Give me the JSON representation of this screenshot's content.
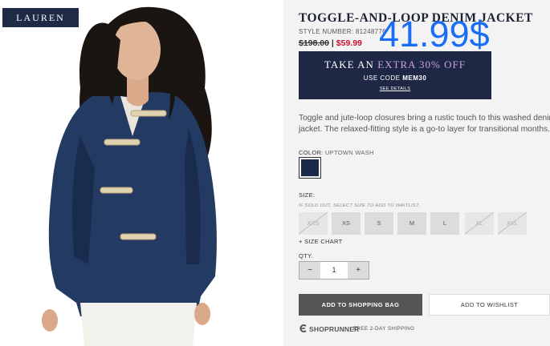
{
  "brand": {
    "logo_text": "LAUREN"
  },
  "product": {
    "title": "TOGGLE-AND-LOOP DENIM JACKET",
    "style_number": "STYLE NUMBER: 81248776",
    "price_original": "$198.00",
    "price_separator": "|",
    "price_sale": "$59.99",
    "price_overlay": "41.99$",
    "description": "Toggle and jute-loop closures bring a rustic touch to this washed denim jacket. The relaxed-fitting style is a go-to layer for transitional months."
  },
  "promo": {
    "line1_prefix": "TAKE AN",
    "line1_accent": "EXTRA 30% OFF",
    "line2_prefix": "USE CODE",
    "line2_code": "MEM30",
    "details_link": "SEE DETAILS"
  },
  "color": {
    "label": "COLOR:",
    "value": "UPTOWN WASH",
    "swatch_hex": "#1c2a4a"
  },
  "size": {
    "label": "SIZE:",
    "sold_out_note": "IF SOLD OUT, SELECT SIZE TO ADD TO WAITLIST.",
    "options": [
      {
        "label": "XXS",
        "available": false
      },
      {
        "label": "XS",
        "available": true
      },
      {
        "label": "S",
        "available": true
      },
      {
        "label": "M",
        "available": true
      },
      {
        "label": "L",
        "available": true
      },
      {
        "label": "XL",
        "available": false
      },
      {
        "label": "XXL",
        "available": false
      }
    ],
    "chart_link": "+ SIZE CHART"
  },
  "quantity": {
    "label": "QTY.",
    "minus": "−",
    "value": "1",
    "plus": "+"
  },
  "actions": {
    "add_to_bag": "ADD TO SHOPPING BAG",
    "add_to_wishlist": "ADD TO WISHLIST"
  },
  "shipping": {
    "logo_text": "SHOPRUNNER",
    "note": "FREE 2-DAY SHIPPING"
  },
  "colors": {
    "navy": "#1e2744",
    "sale_red": "#c8102e",
    "overlay_blue": "#1a6ef5",
    "denim": "#233a63"
  }
}
